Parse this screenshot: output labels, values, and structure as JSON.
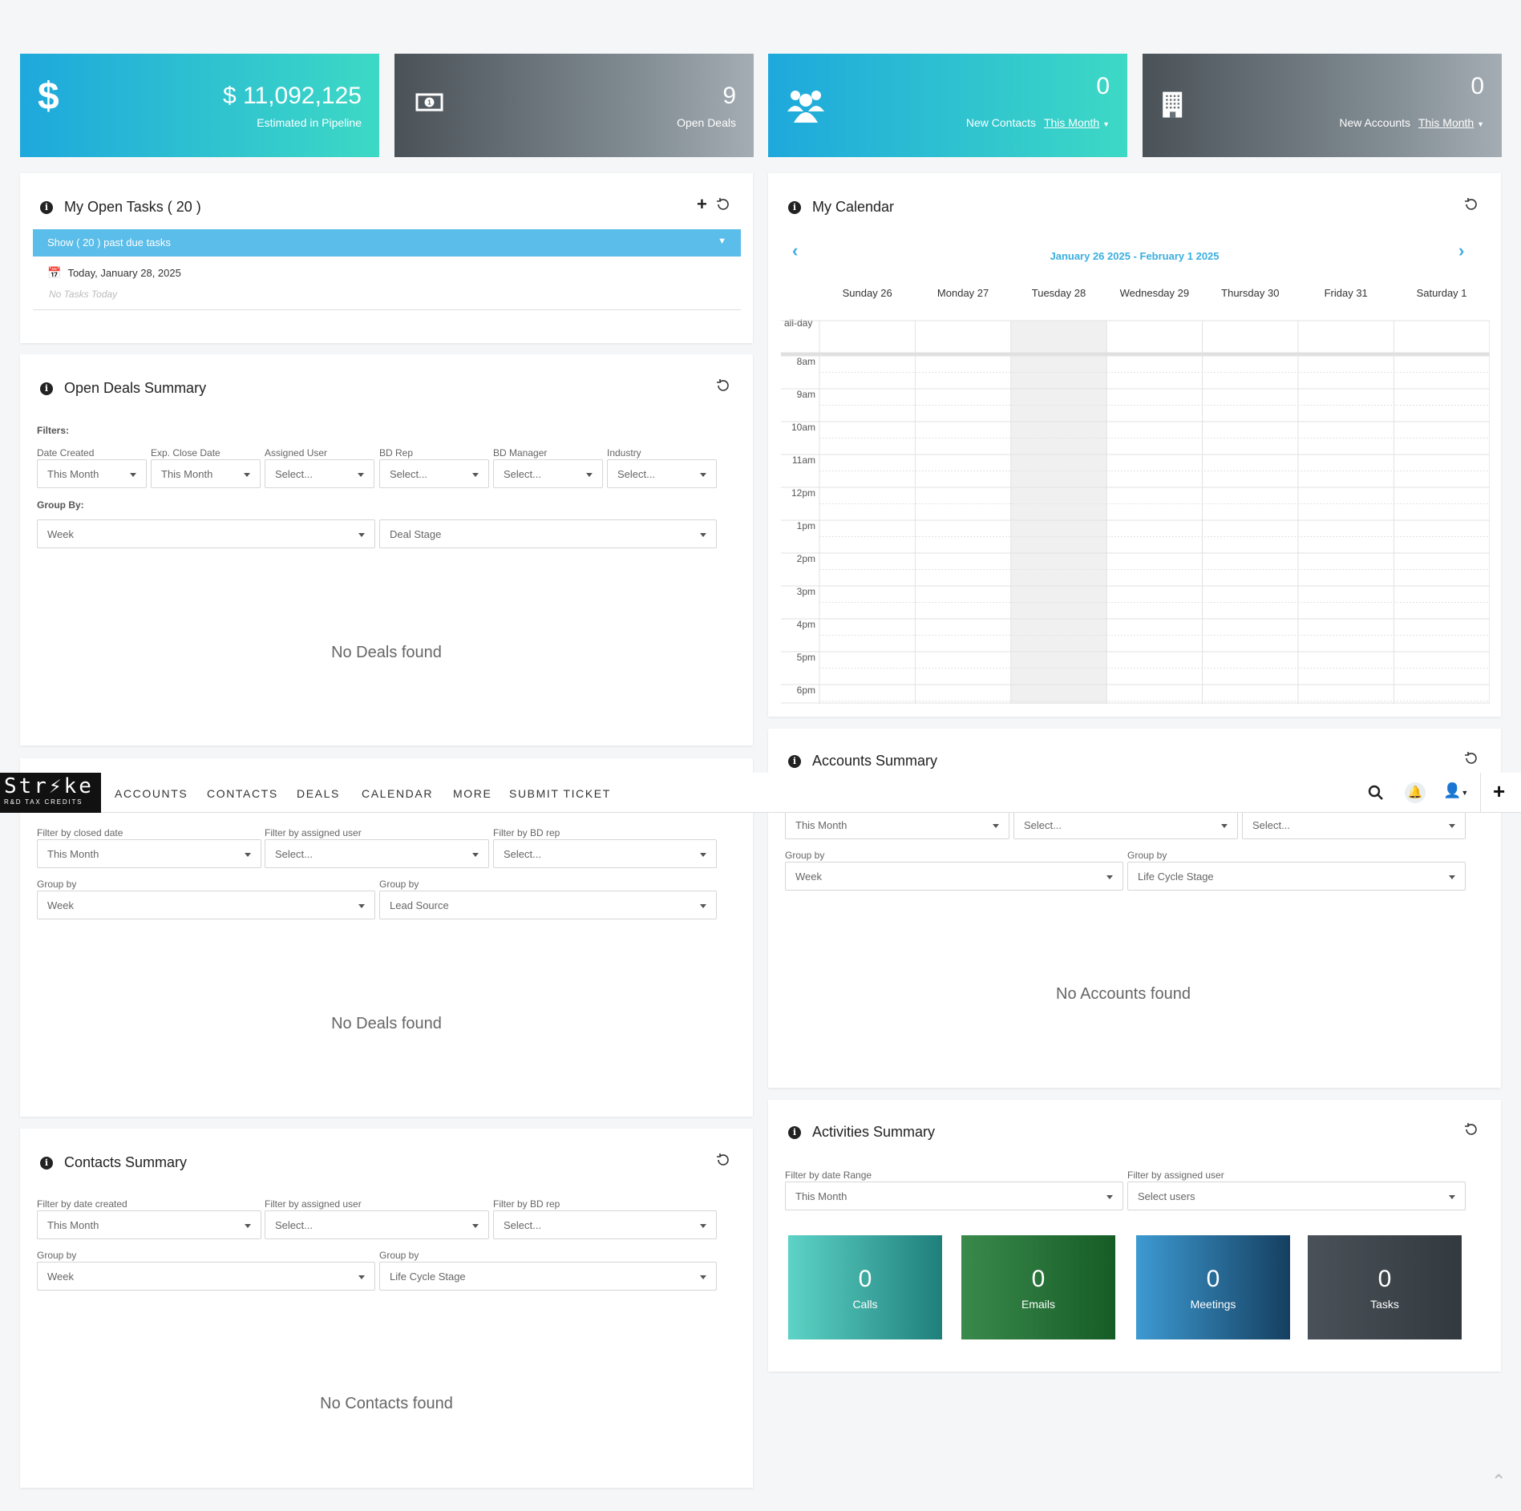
{
  "stats": {
    "pipeline": {
      "value": "$ 11,092,125",
      "label": "Estimated in Pipeline",
      "icon": "dollar-icon"
    },
    "open_deals": {
      "value": "9",
      "label": "Open Deals",
      "icon": "money-bill-icon"
    },
    "new_contacts": {
      "value": "0",
      "label": "New Contacts",
      "period": "This Month",
      "icon": "users-icon"
    },
    "new_accounts": {
      "value": "0",
      "label": "New Accounts",
      "period": "This Month",
      "icon": "building-icon"
    }
  },
  "tasks": {
    "title": "My Open Tasks ( 20 )",
    "past_due": "Show ( 20 ) past due tasks",
    "date": "Today, January 28, 2025",
    "empty": "No Tasks Today"
  },
  "calendar": {
    "title": "My Calendar",
    "range": "January 26 2025 - February 1 2025",
    "days": [
      "Sunday 26",
      "Monday 27",
      "Tuesday 28",
      "Wednesday 29",
      "Thursday 30",
      "Friday 31",
      "Saturday 1"
    ],
    "allday": "all-day",
    "hours": [
      "8am",
      "9am",
      "10am",
      "11am",
      "12pm",
      "1pm",
      "2pm",
      "3pm",
      "4pm",
      "5pm",
      "6pm"
    ]
  },
  "open_deals": {
    "title": "Open Deals Summary",
    "filters_label": "Filters:",
    "filters": [
      {
        "label": "Date Created",
        "value": "This Month"
      },
      {
        "label": "Exp. Close Date",
        "value": "This Month"
      },
      {
        "label": "Assigned User",
        "value": "Select..."
      },
      {
        "label": "BD Rep",
        "value": "Select..."
      },
      {
        "label": "BD Manager",
        "value": "Select..."
      },
      {
        "label": "Industry",
        "value": "Select..."
      }
    ],
    "group_label": "Group By:",
    "group1": "Week",
    "group2": "Deal Stage",
    "empty": "No Deals found"
  },
  "closed_deals": {
    "filters": [
      {
        "label": "Filter by closed date",
        "value": "This Month"
      },
      {
        "label": "Filter by assigned user",
        "value": "Select..."
      },
      {
        "label": "Filter by BD rep",
        "value": "Select..."
      }
    ],
    "group1_label": "Group by",
    "group1": "Week",
    "group2_label": "Group by",
    "group2": "Lead Source",
    "empty": "No Deals found"
  },
  "accounts": {
    "title": "Accounts Summary",
    "filters": [
      "This Month",
      "Select...",
      "Select..."
    ],
    "group1_label": "Group by",
    "group1": "Week",
    "group2_label": "Group by",
    "group2": "Life Cycle Stage",
    "empty": "No Accounts found"
  },
  "contacts": {
    "title": "Contacts Summary",
    "filters": [
      {
        "label": "Filter by date created",
        "value": "This Month"
      },
      {
        "label": "Filter by assigned user",
        "value": "Select..."
      },
      {
        "label": "Filter by BD rep",
        "value": "Select..."
      }
    ],
    "group1_label": "Group by",
    "group1": "Week",
    "group2_label": "Group by",
    "group2": "Life Cycle Stage",
    "empty": "No Contacts found"
  },
  "activities": {
    "title": "Activities Summary",
    "range_label": "Filter by date Range",
    "range": "This Month",
    "user_label": "Filter by assigned user",
    "user": "Select users",
    "tiles": [
      {
        "count": "0",
        "label": "Calls"
      },
      {
        "count": "0",
        "label": "Emails"
      },
      {
        "count": "0",
        "label": "Meetings"
      },
      {
        "count": "0",
        "label": "Tasks"
      }
    ]
  },
  "nav": {
    "logo": "Str⚡ke",
    "logo_sub": "R&D TAX CREDITS",
    "items": [
      "ACCOUNTS",
      "CONTACTS",
      "DEALS",
      "CALENDAR",
      "MORE",
      "SUBMIT TICKET"
    ]
  }
}
